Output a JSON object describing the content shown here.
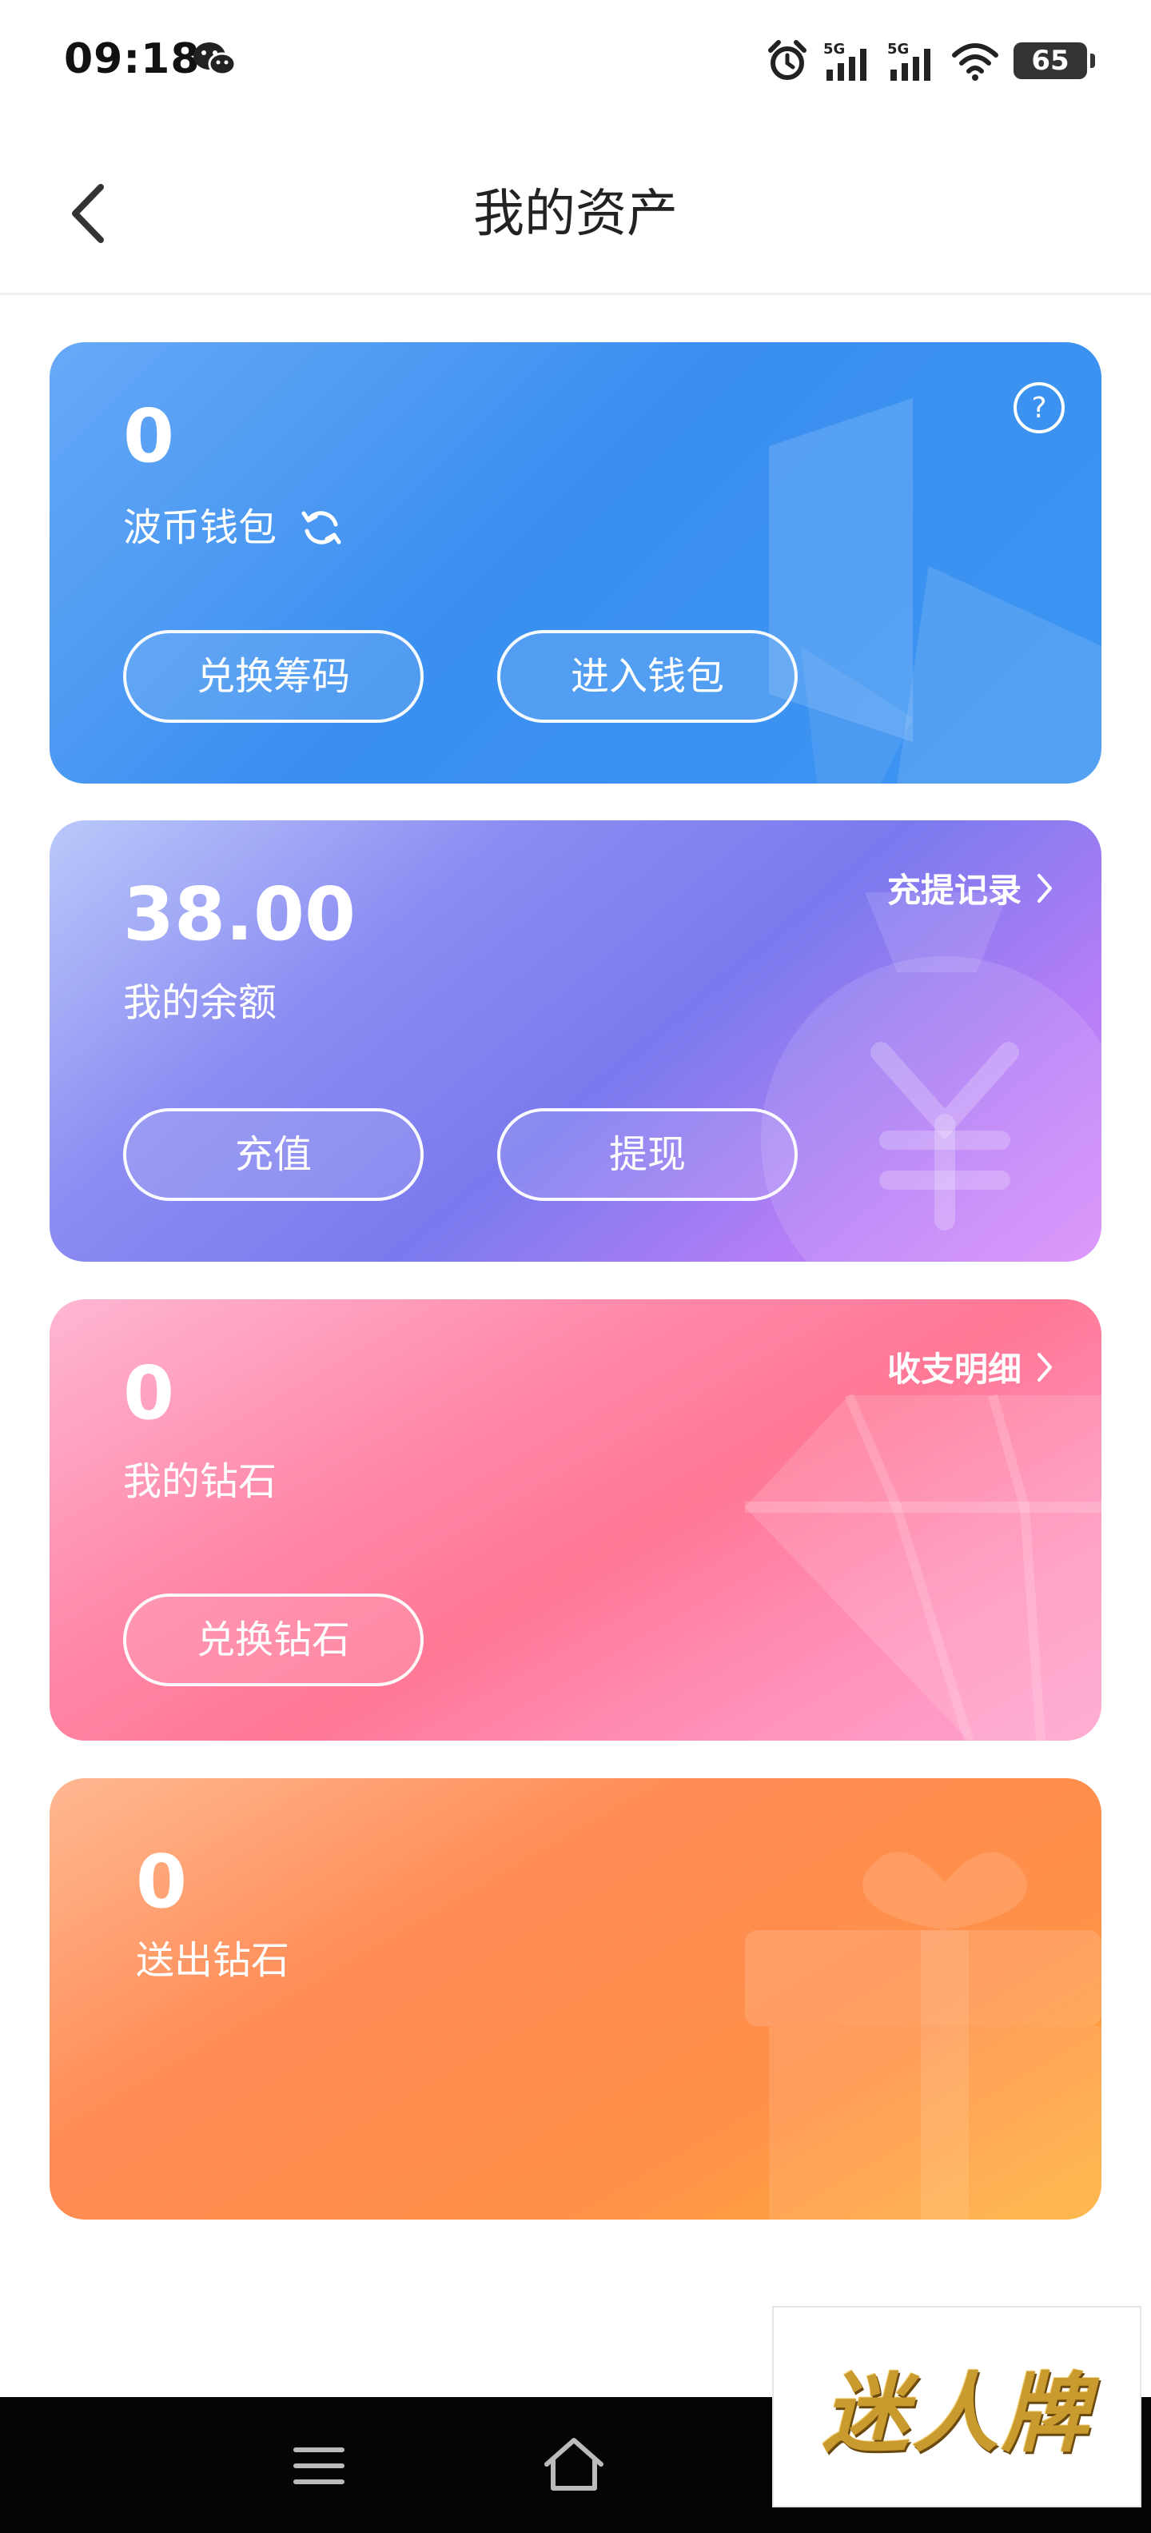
{
  "status_bar": {
    "time": "09:18",
    "network_1": "5G",
    "network_2": "5G",
    "battery": "65"
  },
  "header": {
    "title": "我的资产"
  },
  "cards": [
    {
      "value": "0",
      "label": "波币钱包",
      "buttons": [
        "兑换筹码",
        "进入钱包"
      ],
      "colors": [
        "#67a9f7",
        "#3a8ff0"
      ]
    },
    {
      "value": "38.00",
      "label": "我的余额",
      "link": "充提记录",
      "buttons": [
        "充值",
        "提现"
      ],
      "colors": [
        "#b9c9fa",
        "#7a7aee",
        "#d98bfb"
      ]
    },
    {
      "value": "0",
      "label": "我的钻石",
      "link": "收支明细",
      "buttons": [
        "兑换钻石"
      ],
      "colors": [
        "#ffb6d3",
        "#ff7896",
        "#ffa2cc"
      ]
    },
    {
      "value": "0",
      "label": "送出钻石",
      "colors": [
        "#ffb892",
        "#ff8c55",
        "#ffb13a"
      ]
    }
  ],
  "watermark": {
    "text": "迷人牌"
  }
}
